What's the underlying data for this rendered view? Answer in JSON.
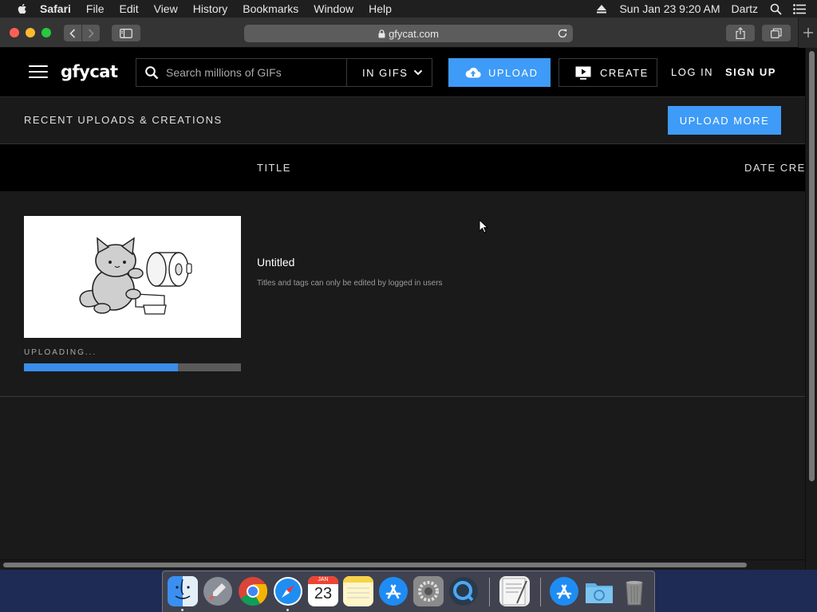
{
  "menubar": {
    "items": [
      "Safari",
      "File",
      "Edit",
      "View",
      "History",
      "Bookmarks",
      "Window",
      "Help"
    ],
    "datetime": "Sun Jan 23  9:20 AM",
    "user": "Dartz"
  },
  "browser": {
    "url": "gfycat.com"
  },
  "site": {
    "logo": "gfycat",
    "search_placeholder": "Search millions of GIFs",
    "search_scope": "IN GIFS",
    "upload_label": "UPLOAD",
    "create_label": "CREATE",
    "login_label": "LOG IN",
    "signup_label": "SIGN UP",
    "recent_title": "RECENT UPLOADS & CREATIONS",
    "upload_more_label": "UPLOAD MORE",
    "columns": {
      "title": "TITLE",
      "date": "DATE CREA"
    },
    "upload": {
      "status": "UPLOADING...",
      "progress": 0.71,
      "title": "Untitled",
      "subtitle": "Titles and tags can only be edited by logged in users"
    }
  },
  "dock": {
    "calendar_month": "JAN",
    "calendar_day": "23"
  },
  "colors": {
    "accent": "#3e9bf7",
    "progress": "#3a8eea",
    "header_bg": "#000000",
    "page_bg": "#1a1a1a"
  }
}
